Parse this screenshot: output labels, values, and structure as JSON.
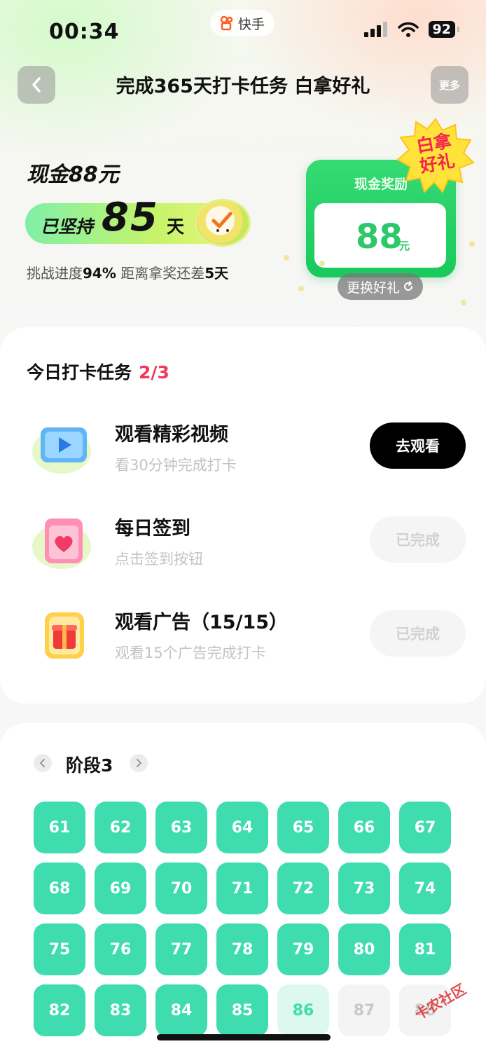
{
  "status_bar": {
    "time": "00:34",
    "app_name": "快手",
    "battery": "92"
  },
  "nav": {
    "title": "完成365天打卡任务 白拿好礼",
    "back_icon": "chevron-left-icon",
    "more_label": "更多"
  },
  "hero": {
    "cash_title": "现金88元",
    "streak_prefix": "已坚持",
    "streak_days": "85",
    "streak_suffix": "天",
    "progress_label": "挑战进度",
    "progress_value": "94%",
    "remaining_label": "距离拿奖还差",
    "remaining_value": "5天",
    "progress_fraction": 0.94
  },
  "reward": {
    "label": "现金奖励",
    "amount": "88",
    "unit": "元",
    "badge_line1": "白拿",
    "badge_line2": "好礼",
    "swap_label": "更换好礼",
    "swap_icon": "refresh-icon"
  },
  "tasks": {
    "title": "今日打卡任务",
    "count": "2/3",
    "items": [
      {
        "title": "观看精彩视频",
        "subtitle": "看30分钟完成打卡",
        "button": "去观看",
        "state": "todo",
        "icon": "video-play-icon"
      },
      {
        "title": "每日签到",
        "subtitle": "点击签到按钮",
        "button": "已完成",
        "state": "done",
        "icon": "calendar-heart-icon"
      },
      {
        "title": "观看广告（15/15）",
        "subtitle": "观看15个广告完成打卡",
        "button": "已完成",
        "state": "done",
        "icon": "gift-icon"
      }
    ]
  },
  "stage": {
    "title": "阶段3",
    "days": [
      {
        "n": "61",
        "s": "done"
      },
      {
        "n": "62",
        "s": "done"
      },
      {
        "n": "63",
        "s": "done"
      },
      {
        "n": "64",
        "s": "done"
      },
      {
        "n": "65",
        "s": "done"
      },
      {
        "n": "66",
        "s": "done"
      },
      {
        "n": "67",
        "s": "done"
      },
      {
        "n": "68",
        "s": "done"
      },
      {
        "n": "69",
        "s": "done"
      },
      {
        "n": "70",
        "s": "done"
      },
      {
        "n": "71",
        "s": "done"
      },
      {
        "n": "72",
        "s": "done"
      },
      {
        "n": "73",
        "s": "done"
      },
      {
        "n": "74",
        "s": "done"
      },
      {
        "n": "75",
        "s": "done"
      },
      {
        "n": "76",
        "s": "done"
      },
      {
        "n": "77",
        "s": "done"
      },
      {
        "n": "78",
        "s": "done"
      },
      {
        "n": "79",
        "s": "done"
      },
      {
        "n": "80",
        "s": "done"
      },
      {
        "n": "81",
        "s": "done"
      },
      {
        "n": "82",
        "s": "done"
      },
      {
        "n": "83",
        "s": "done"
      },
      {
        "n": "84",
        "s": "done"
      },
      {
        "n": "85",
        "s": "done"
      },
      {
        "n": "86",
        "s": "today"
      },
      {
        "n": "87",
        "s": "future"
      },
      {
        "n": "88",
        "s": "future"
      }
    ]
  },
  "watermark": "卡农社区",
  "colors": {
    "accent_green": "#3edcae",
    "reward_green": "#19c95c",
    "count_red": "#f2375a"
  }
}
